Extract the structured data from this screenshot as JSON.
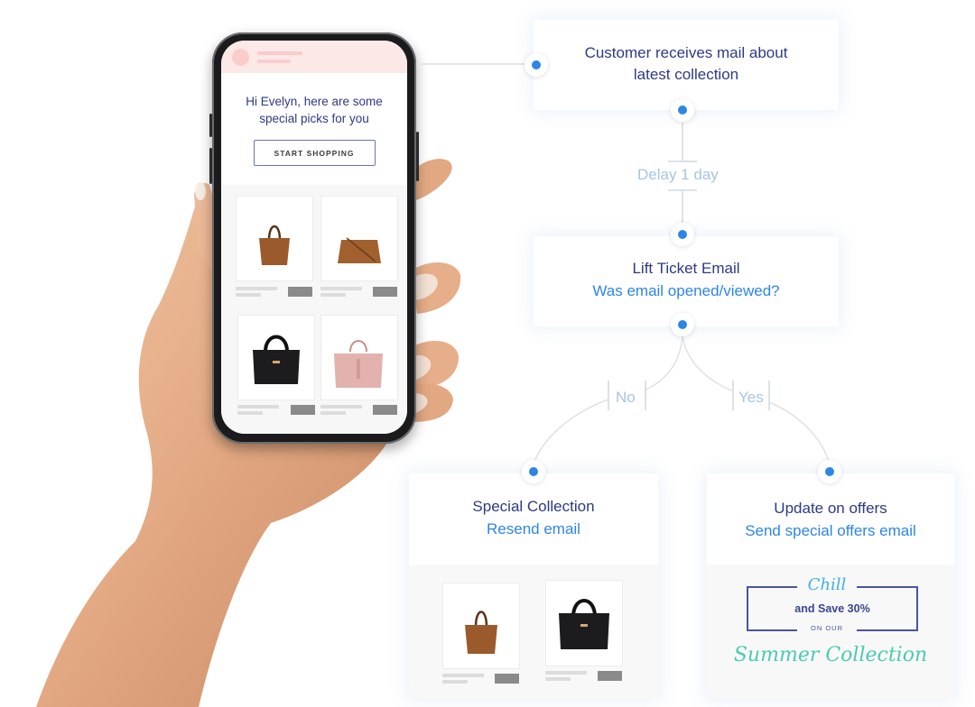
{
  "phone_email": {
    "greeting": "Hi Evelyn, here are some special picks for you",
    "greeting_line1": "Hi Evelyn, here are some",
    "greeting_line2": "special picks for you",
    "cta_label": "START SHOPPING",
    "products": [
      {
        "name": "brown-tote-bag",
        "color": "#9a5a2c"
      },
      {
        "name": "brown-crossbody-bag",
        "color": "#a2602f"
      },
      {
        "name": "black-satchel-bag",
        "color": "#1c1c1e"
      },
      {
        "name": "pink-satchel-bag",
        "color": "#e3b2ae"
      }
    ]
  },
  "flow": {
    "start_node": {
      "title_line1": "Customer receives mail about",
      "title_line2": "latest collection"
    },
    "delay_label": "Delay 1 day",
    "decision_node": {
      "title": "Lift Ticket Email",
      "subtitle": "Was email opened/viewed?"
    },
    "branch_no_label": "No",
    "branch_yes_label": "Yes",
    "no_node": {
      "title": "Special Collection",
      "subtitle": "Resend email",
      "products": [
        {
          "name": "brown-tote-bag",
          "color": "#9a5a2c"
        },
        {
          "name": "black-satchel-bag",
          "color": "#1c1c1e"
        }
      ]
    },
    "yes_node": {
      "title": "Update on offers",
      "subtitle": "Send special offers email",
      "offer": {
        "headline": "Chill",
        "discount_text": "and Save 30%",
        "connector_text": "ON OUR",
        "collection_text": "Summer Collection"
      }
    }
  },
  "colors": {
    "title": "#2e3a83",
    "accent_blue": "#2d86e5",
    "edge_label": "#a8c4e3",
    "offer_teal": "#4ccbb0",
    "offer_sky": "#3fb2e0"
  }
}
